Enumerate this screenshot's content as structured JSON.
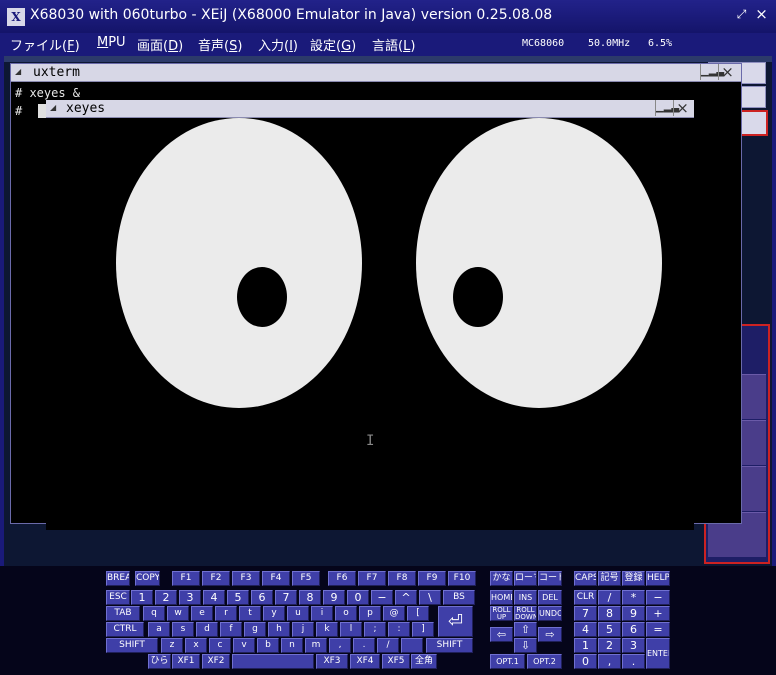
{
  "window": {
    "title": "X68030 with 060turbo - XEiJ (X68000 Emulator in Java) version 0.25.08.08",
    "icon_glyph": "X",
    "restore_glyph": "⤢",
    "close_glyph": "×"
  },
  "menubar": {
    "items": [
      {
        "label": "ファイル(",
        "key": "F",
        "suffix": ")"
      },
      {
        "label": "",
        "key": "M",
        "suffix": "PU"
      },
      {
        "label": "画面(",
        "key": "D",
        "suffix": ")"
      },
      {
        "label": "音声(",
        "key": "S",
        "suffix": ")"
      },
      {
        "label": "入力(",
        "key": "I",
        "suffix": ")"
      },
      {
        "label": "設定(",
        "key": "G",
        "suffix": ")"
      },
      {
        "label": "言語(",
        "key": "L",
        "suffix": ")"
      }
    ],
    "cpu": "MC68060",
    "clock": "50.0MHz",
    "load": "6.5%"
  },
  "uxterm": {
    "title": "uxterm",
    "lines": [
      "# xeyes &",
      "#"
    ],
    "resize_glyph": "▁▂▃",
    "close_glyph": "×"
  },
  "xeyes": {
    "title": "xeyes",
    "resize_glyph": "▁▂▃",
    "close_glyph": "×"
  },
  "background": {
    "partial_text": "es",
    "accent_red": "#cc2222",
    "accent_purple": "#4a3d8a"
  },
  "keyboard": {
    "colors": {
      "key": "#3f3fa8",
      "border": "#7070d0"
    },
    "top_row": [
      "BREAK",
      "COPY",
      "F1",
      "F2",
      "F3",
      "F4",
      "F5",
      "F6",
      "F7",
      "F8",
      "F9",
      "F10",
      "かな",
      "ローマ",
      "コード",
      "CAPS",
      "記号",
      "登録",
      "HELP"
    ],
    "row1": [
      "ESC",
      "1",
      "2",
      "3",
      "4",
      "5",
      "6",
      "7",
      "8",
      "9",
      "0",
      "−",
      "^",
      "\\",
      "BS"
    ],
    "row2": [
      "TAB",
      "q",
      "w",
      "e",
      "r",
      "t",
      "y",
      "u",
      "i",
      "o",
      "p",
      "@",
      "["
    ],
    "row3": [
      "CTRL",
      "a",
      "s",
      "d",
      "f",
      "g",
      "h",
      "j",
      "k",
      "l",
      ";",
      ":",
      "]"
    ],
    "row4": [
      "SHIFT",
      "z",
      "x",
      "c",
      "v",
      "b",
      "n",
      "m",
      ",",
      ".",
      "/",
      "",
      "SHIFT"
    ],
    "row5": [
      "ひら",
      "XF1",
      "XF2",
      "",
      "XF3",
      "XF4",
      "XF5",
      "全角"
    ],
    "return_glyph": "⏎",
    "nav": [
      "HOME",
      "INS",
      "DEL",
      "ROLL UP",
      "ROLL DOWN",
      "UNDO",
      "⇦",
      "⇧",
      "⇨",
      "⇩",
      "OPT.1",
      "OPT.2"
    ],
    "numpad": [
      "CLR",
      "/",
      "*",
      "−",
      "7",
      "8",
      "9",
      "+",
      "4",
      "5",
      "6",
      "=",
      "1",
      "2",
      "3",
      "ENTER",
      "0",
      ",",
      "."
    ]
  }
}
